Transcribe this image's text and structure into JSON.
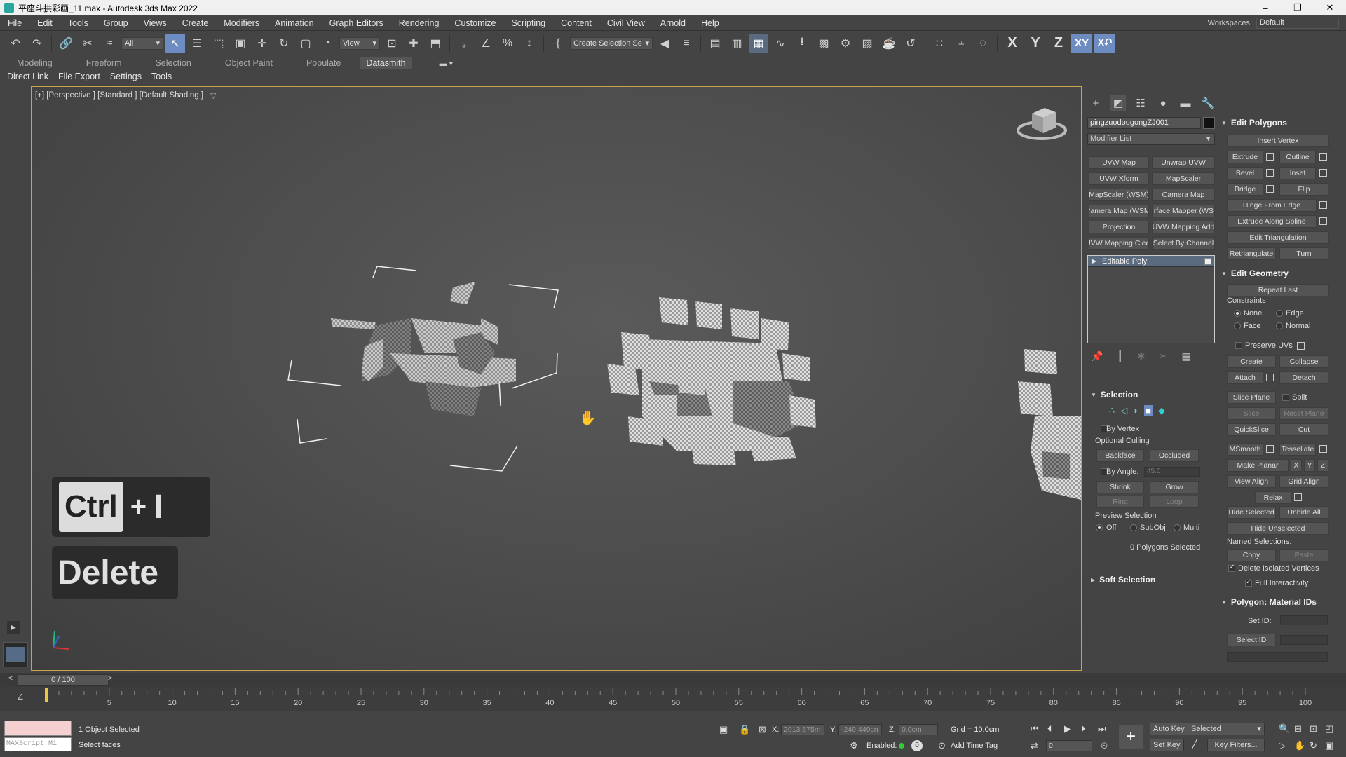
{
  "window": {
    "title": "平座斗拱彩画_11.max - Autodesk 3ds Max 2022",
    "controls": {
      "minimize": "–",
      "restore": "❐",
      "close": "✕"
    }
  },
  "menu": {
    "items": [
      "File",
      "Edit",
      "Tools",
      "Group",
      "Views",
      "Create",
      "Modifiers",
      "Animation",
      "Graph Editors",
      "Rendering",
      "Customize",
      "Scripting",
      "Content",
      "Civil View",
      "Arnold",
      "Help"
    ],
    "workspaces_label": "Workspaces:",
    "workspaces_value": "Default"
  },
  "toolbar": {
    "filter_value": "All",
    "refcoord_value": "View",
    "selection_set_placeholder": "Create Selection Se",
    "axes": [
      "X",
      "Y",
      "Z",
      "XY"
    ],
    "xy_active": "XY"
  },
  "ribbon": {
    "tabs": [
      "Modeling",
      "Freeform",
      "Selection",
      "Object Paint",
      "Populate",
      "Datasmith"
    ],
    "active_tab": "Datasmith"
  },
  "subbar": {
    "items": [
      "Direct Link",
      "File Export",
      "Settings",
      "Tools"
    ]
  },
  "viewport": {
    "label": "[+] [Perspective ] [Standard ] [Default Shading ]",
    "keys": {
      "ctrl": "Ctrl",
      "plus": "+",
      "i": "I",
      "delete": "Delete"
    }
  },
  "command_panel": {
    "object_name": "pingzuodougongZJ001",
    "object_color": "#111111",
    "modifier_list": "Modifier List",
    "modifier_buttons": [
      [
        "UVW Map",
        "Unwrap UVW"
      ],
      [
        "UVW Xform",
        "MapScaler"
      ],
      [
        "MapScaler (WSM)",
        "Camera Map"
      ],
      [
        "Camera Map (WSM)",
        "Surface Mapper (WSM)"
      ],
      [
        "Projection",
        "UVW Mapping Add"
      ],
      [
        "UVW Mapping Clear",
        "Select By Channel"
      ]
    ],
    "stack_item": "Editable Poly",
    "selection": {
      "title": "Selection",
      "by_vertex": "By Vertex",
      "optional_culling": "Optional Culling",
      "backface": "Backface",
      "occluded": "Occluded",
      "by_angle": "By Angle:",
      "angle_value": "45.0",
      "shrink": "Shrink",
      "grow": "Grow",
      "ring": "Ring",
      "loop": "Loop",
      "preview_selection": "Preview Selection",
      "preview_off": "Off",
      "preview_subobj": "SubObj",
      "preview_multi": "Multi",
      "status": "0 Polygons Selected"
    },
    "soft_selection": "Soft Selection",
    "edit_polygons": {
      "title": "Edit Polygons",
      "insert_vertex": "Insert Vertex",
      "extrude": "Extrude",
      "outline": "Outline",
      "bevel": "Bevel",
      "inset": "Inset",
      "bridge": "Bridge",
      "flip": "Flip",
      "hinge_from_edge": "Hinge From Edge",
      "extrude_along_spline": "Extrude Along Spline",
      "edit_triangulation": "Edit Triangulation",
      "retriangulate": "Retriangulate",
      "turn": "Turn"
    },
    "edit_geometry": {
      "title": "Edit Geometry",
      "repeat_last": "Repeat Last",
      "constraints": "Constraints",
      "none": "None",
      "edge": "Edge",
      "face": "Face",
      "normal": "Normal",
      "preserve_uvs": "Preserve UVs",
      "create": "Create",
      "collapse": "Collapse",
      "attach": "Attach",
      "detach": "Detach",
      "slice_plane": "Slice Plane",
      "split": "Split",
      "slice": "Slice",
      "reset_plane": "Reset Plane",
      "quickslice": "QuickSlice",
      "cut": "Cut",
      "msmooth": "MSmooth",
      "tessellate": "Tessellate",
      "make_planar": "Make Planar",
      "x": "X",
      "y": "Y",
      "z": "Z",
      "view_align": "View Align",
      "grid_align": "Grid Align",
      "relax": "Relax",
      "hide_selected": "Hide Selected",
      "unhide_all": "Unhide All",
      "hide_unselected": "Hide Unselected",
      "named_selections": "Named Selections:",
      "copy": "Copy",
      "paste": "Paste",
      "delete_isolated": "Delete Isolated Vertices",
      "full_interactivity": "Full Interactivity"
    },
    "material_ids": {
      "title": "Polygon: Material IDs",
      "set_id": "Set ID:",
      "select_id": "Select ID"
    }
  },
  "timeline": {
    "frame_display": "0 / 100",
    "ticks": [
      5,
      10,
      15,
      20,
      25,
      30,
      35,
      40,
      45,
      50,
      55,
      60,
      65,
      70,
      75,
      80,
      85,
      90,
      95,
      100
    ],
    "start": 0,
    "end": 100,
    "current": 0
  },
  "status": {
    "maxscript_placeholder": "MAXScript Mi",
    "objects_selected": "1 Object Selected",
    "prompt": "Select faces",
    "x_label": "X:",
    "x_value": "2013.675m",
    "y_label": "Y:",
    "y_value": "-249.449cn",
    "z_label": "Z:",
    "z_value": "0.0cm",
    "grid": "Grid = 10.0cm",
    "enabled_label": "Enabled:",
    "add_time_tag": "Add Time Tag",
    "auto_key": "Auto Key",
    "set_key": "Set Key",
    "key_mode": "Selected",
    "key_filters": "Key Filters...",
    "frame_value": "0"
  }
}
